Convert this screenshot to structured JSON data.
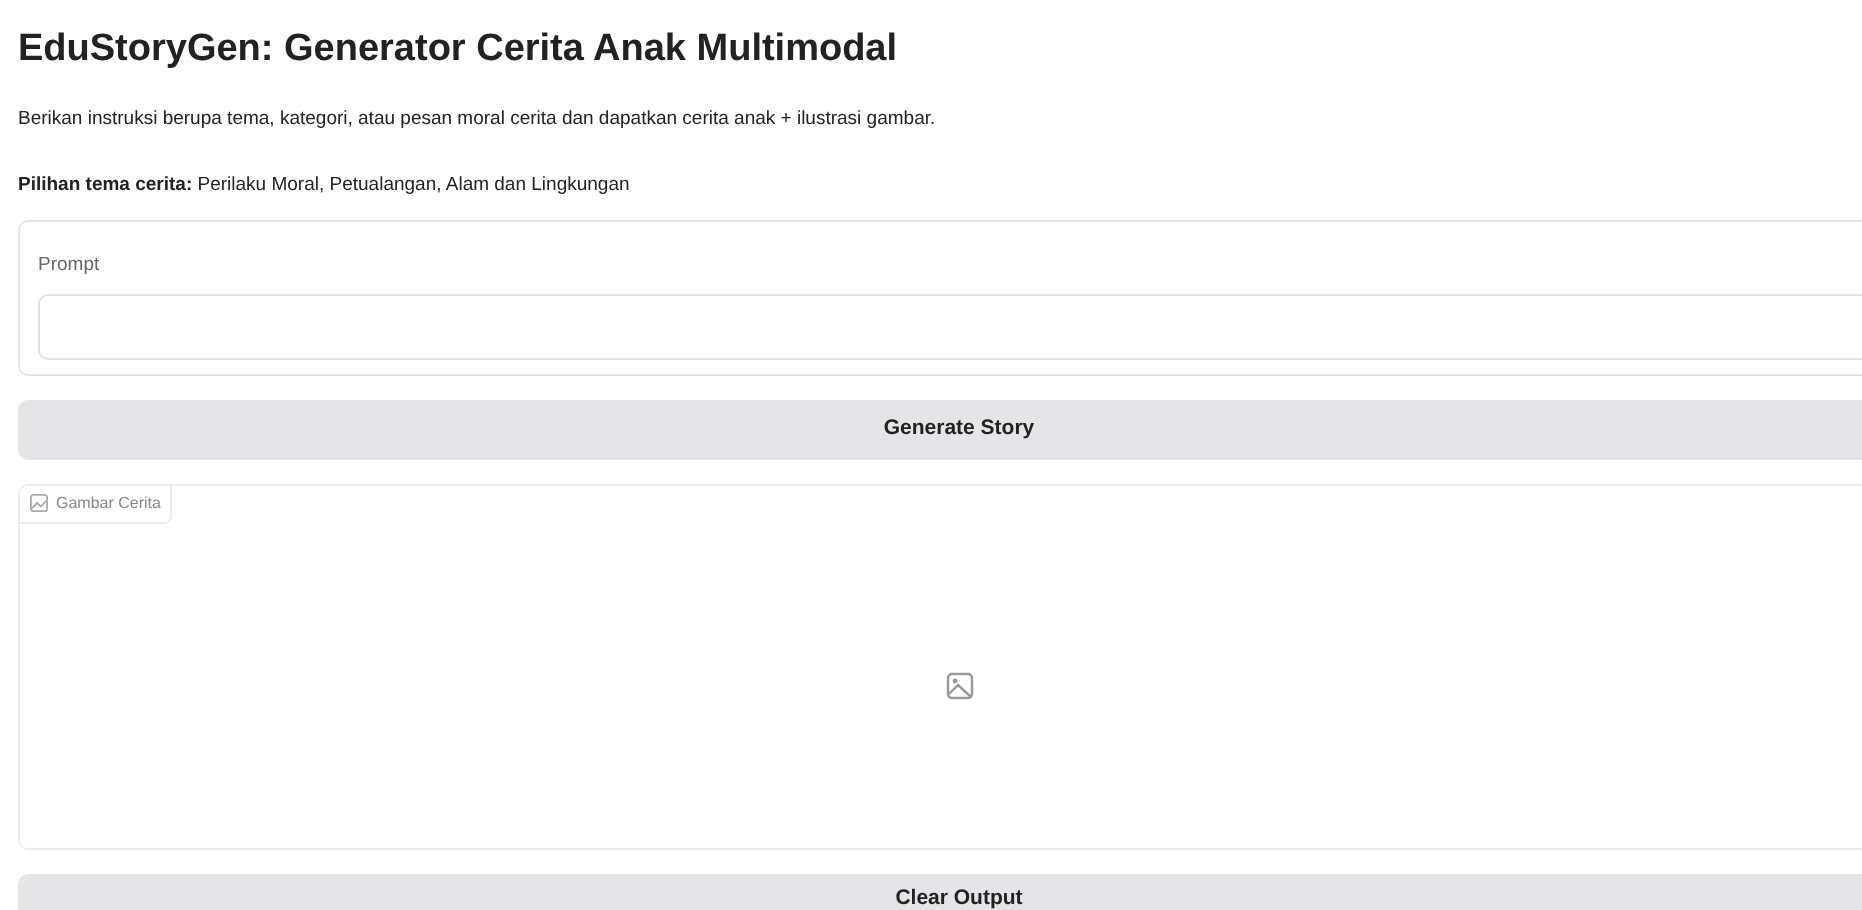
{
  "title": "EduStoryGen: Generator Cerita Anak Multimodal",
  "description": "Berikan instruksi berupa tema, kategori, atau pesan moral cerita dan dapatkan cerita anak + ilustrasi gambar.",
  "themes": "**Pilihan tema cerita:** Perilaku Moral, Petualangan, Alam dan Lingkungan",
  "prompt": {
    "label": "Prompt"
  },
  "generate_button": "Generate Story",
  "image_output": {
    "label": "Gambar Cerita"
  },
  "clear_button": "Clear Output"
}
